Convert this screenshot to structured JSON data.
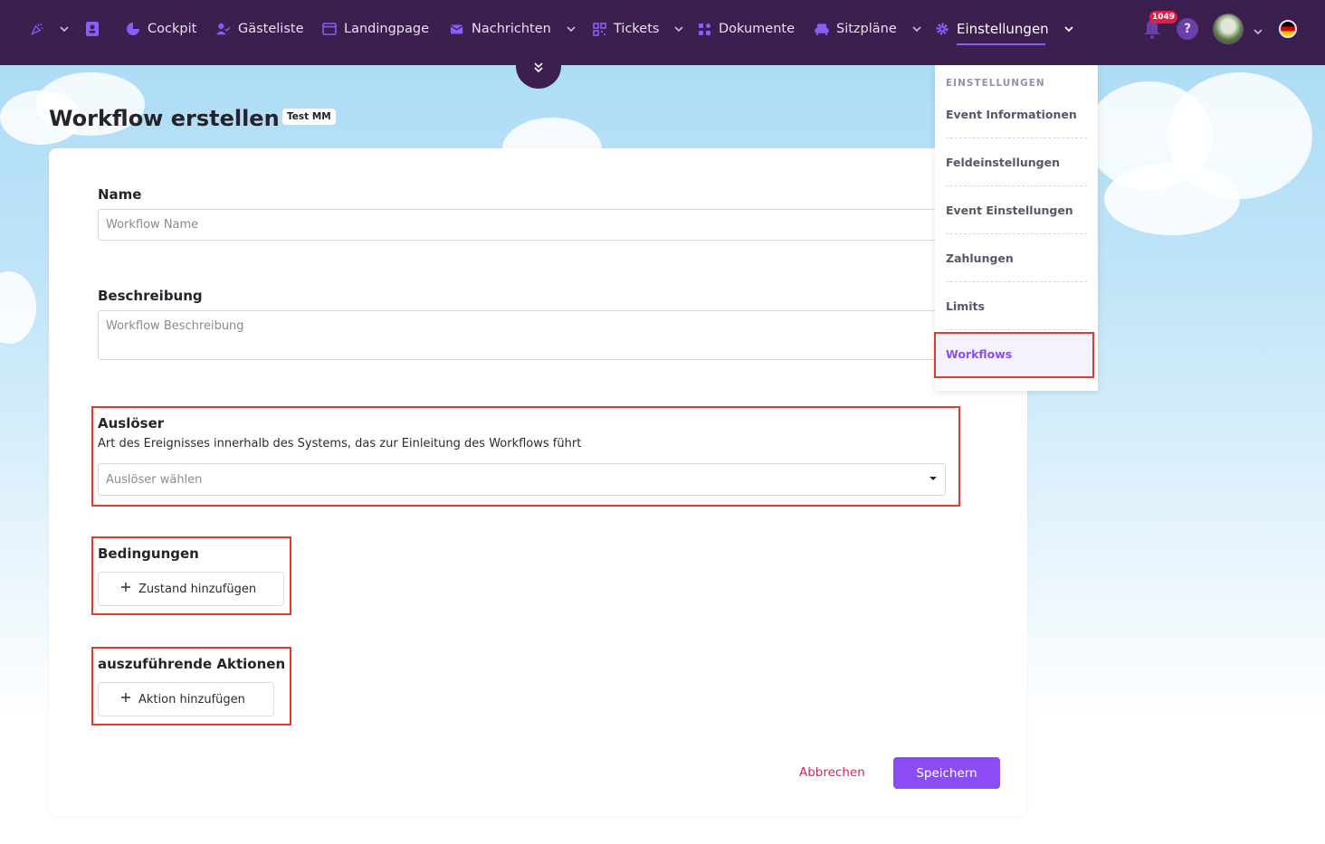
{
  "nav": {
    "items": [
      {
        "label": "Cockpit"
      },
      {
        "label": "Gästeliste"
      },
      {
        "label": "Landingpage"
      },
      {
        "label": "Nachrichten"
      },
      {
        "label": "Tickets"
      },
      {
        "label": "Dokumente"
      },
      {
        "label": "Sitzpläne"
      },
      {
        "label": "Einstellungen"
      }
    ],
    "notification_count": "1049",
    "help_label": "?"
  },
  "page": {
    "title": "Workflow erstellen",
    "event_badge": "Test MM"
  },
  "form": {
    "name_label": "Name",
    "name_placeholder": "Workflow Name",
    "description_label": "Beschreibung",
    "description_placeholder": "Workflow Beschreibung",
    "trigger_label": "Auslöser",
    "trigger_help": "Art des Ereignisses innerhalb des Systems, das zur Einleitung des Workflows führt",
    "trigger_placeholder": "Auslöser wählen",
    "conditions_label": "Bedingungen",
    "add_condition_label": "Zustand hinzufügen",
    "actions_label": "auszuführende Aktionen",
    "add_action_label": "Aktion hinzufügen",
    "cancel_label": "Abbrechen",
    "save_label": "Speichern"
  },
  "settings_menu": {
    "heading": "EINSTELLUNGEN",
    "items": [
      {
        "label": "Event Informationen"
      },
      {
        "label": "Feldeinstellungen"
      },
      {
        "label": "Event Einstellungen"
      },
      {
        "label": "Zahlungen"
      },
      {
        "label": "Limits"
      },
      {
        "label": "Workflows"
      }
    ],
    "active": "Workflows"
  },
  "colors": {
    "topbar": "#3a1f4f",
    "accent": "#8b4cf6",
    "highlight": "#e53a2b",
    "cancel": "#d6245a"
  }
}
